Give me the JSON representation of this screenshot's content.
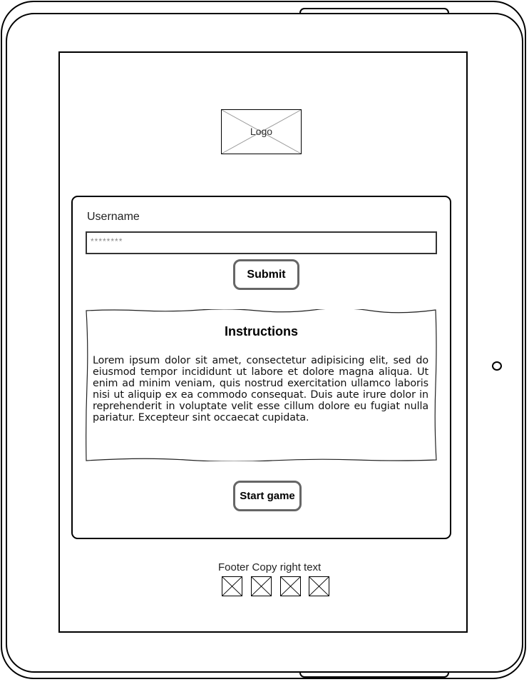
{
  "logo": {
    "label": "Logo"
  },
  "form": {
    "username_label": "Username",
    "username_value": "********",
    "submit_label": "Submit"
  },
  "instructions": {
    "title": "Instructions",
    "body": "Lorem ipsum dolor sit amet, consectetur adipisicing elit, sed do eiusmod tempor incididunt ut labore et dolore magna aliqua. Ut enim ad minim veniam, quis nostrud exercitation ullamco laboris nisi ut aliquip ex ea commodo consequat. Duis aute irure dolor in reprehenderit in voluptate velit esse cillum dolore eu fugiat nulla pariatur. Excepteur sint occaecat cupidata."
  },
  "start_game_label": "Start game",
  "footer": {
    "text": "Footer Copy right text",
    "icons": [
      "image-placeholder-icon",
      "image-placeholder-icon",
      "image-placeholder-icon",
      "image-placeholder-icon"
    ]
  }
}
